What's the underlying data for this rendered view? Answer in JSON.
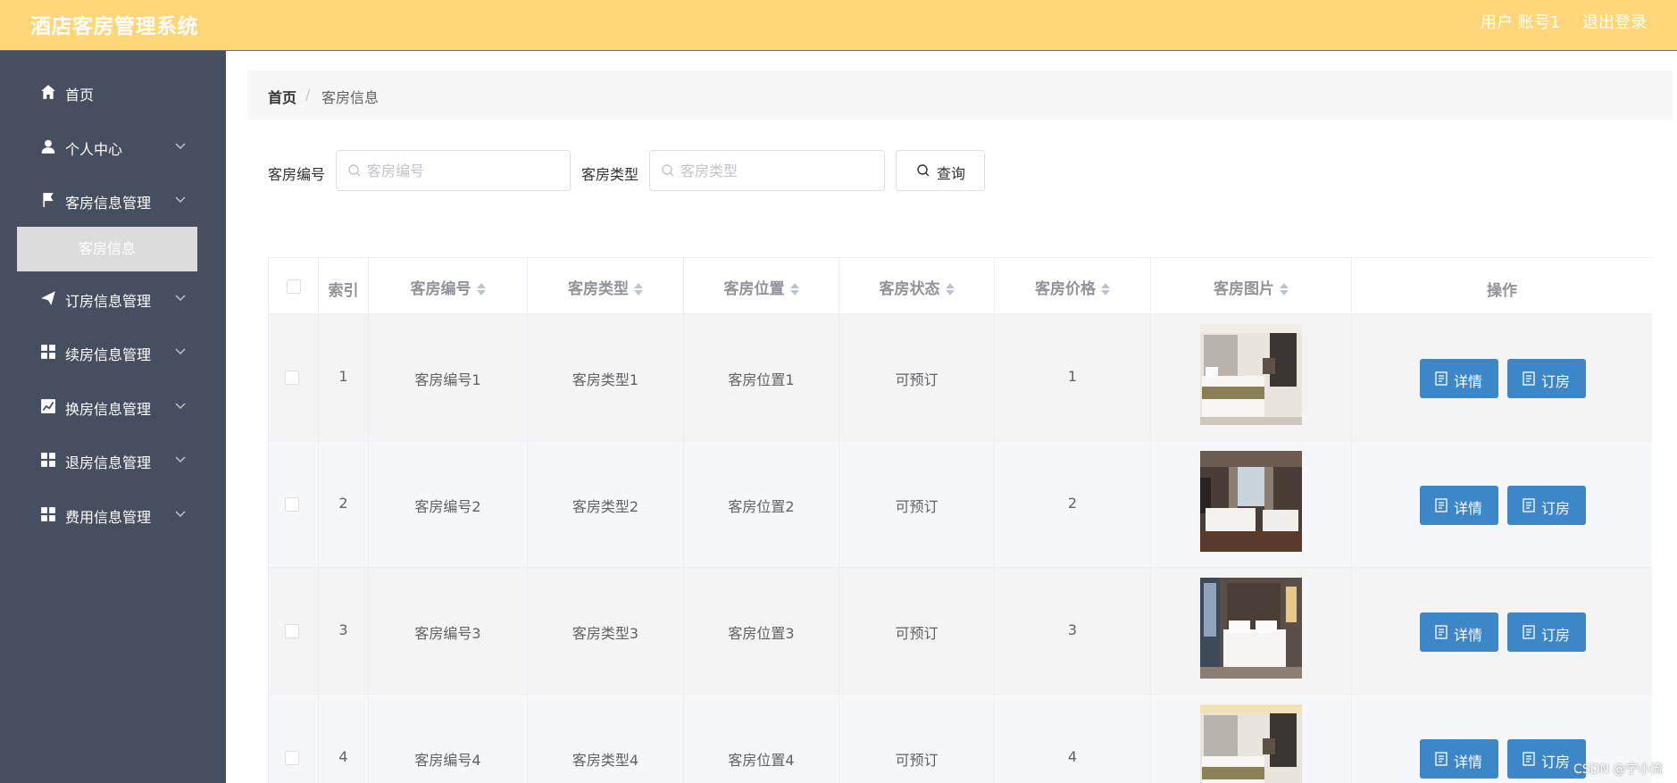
{
  "header": {
    "title": "酒店客房管理系统",
    "user": "用户 账号1",
    "logout": "退出登录"
  },
  "sidebar": {
    "items": [
      {
        "label": "首页",
        "icon": "home-icon"
      },
      {
        "label": "个人中心",
        "icon": "user-icon"
      },
      {
        "label": "客房信息管理",
        "icon": "flag-icon"
      },
      {
        "label": "订房信息管理",
        "icon": "send-icon"
      },
      {
        "label": "续房信息管理",
        "icon": "grid-icon"
      },
      {
        "label": "换房信息管理",
        "icon": "chart-icon"
      },
      {
        "label": "退房信息管理",
        "icon": "grid-icon"
      },
      {
        "label": "费用信息管理",
        "icon": "grid-icon"
      }
    ],
    "active_sub": "客房信息"
  },
  "breadcrumb": {
    "home": "首页",
    "separator": "/",
    "current": "客房信息"
  },
  "search": {
    "room_no_label": "客房编号",
    "room_no_placeholder": "客房编号",
    "room_type_label": "客房类型",
    "room_type_placeholder": "客房类型",
    "query_label": "查询"
  },
  "table": {
    "headers": {
      "index": "索引",
      "room_no": "客房编号",
      "room_type": "客房类型",
      "room_location": "客房位置",
      "room_status": "客房状态",
      "room_price": "客房价格",
      "room_image": "客房图片",
      "actions": "操作"
    },
    "detail_label": "详情",
    "book_label": "订房",
    "rows": [
      {
        "index": "1",
        "room_no": "客房编号1",
        "room_type": "客房类型1",
        "room_location": "客房位置1",
        "room_status": "可预订",
        "room_price": "1"
      },
      {
        "index": "2",
        "room_no": "客房编号2",
        "room_type": "客房类型2",
        "room_location": "客房位置2",
        "room_status": "可预订",
        "room_price": "2"
      },
      {
        "index": "3",
        "room_no": "客房编号3",
        "room_type": "客房类型3",
        "room_location": "客房位置3",
        "room_status": "可预订",
        "room_price": "3"
      },
      {
        "index": "4",
        "room_no": "客房编号4",
        "room_type": "客房类型4",
        "room_location": "客房位置4",
        "room_status": "可预订",
        "room_price": "4"
      }
    ]
  },
  "watermark": "CSDN @宁小流",
  "colors": {
    "header_bg": "#ffd77a",
    "sidebar_bg": "#454f5f",
    "primary_button": "#3d87c9"
  }
}
